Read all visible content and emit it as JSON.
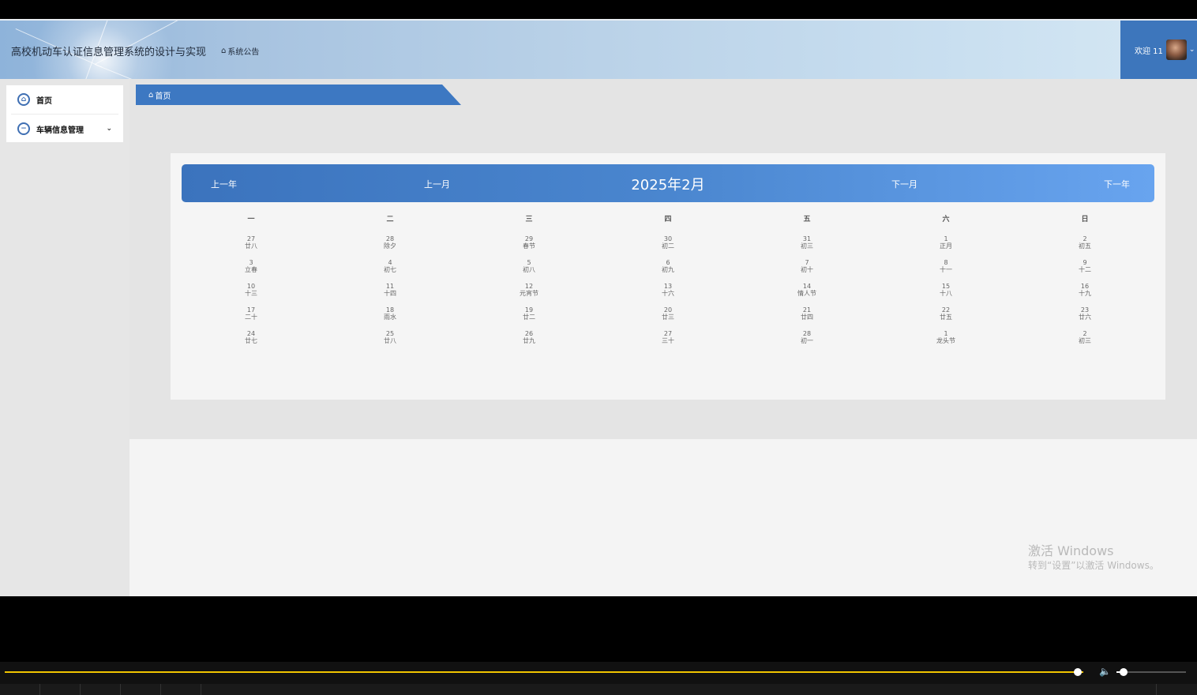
{
  "header": {
    "app_title": "高校机动车认证信息管理系统的设计与实现",
    "notice_label": "系统公告",
    "welcome_text": "欢迎 11"
  },
  "sidebar": {
    "items": [
      {
        "label": "首页",
        "icon": "home-icon"
      },
      {
        "label": "车辆信息管理",
        "icon": "minus-circle-icon"
      }
    ]
  },
  "breadcrumb": {
    "label": "首页",
    "icon": "home-icon"
  },
  "calendar": {
    "title": "2025年2月",
    "prev_year": "上一年",
    "prev_month": "上一月",
    "next_month": "下一月",
    "next_year": "下一年",
    "weekdays": [
      "一",
      "二",
      "三",
      "四",
      "五",
      "六",
      "日"
    ],
    "weeks": [
      [
        {
          "d": "27",
          "l": "廿八"
        },
        {
          "d": "28",
          "l": "除夕"
        },
        {
          "d": "29",
          "l": "春节"
        },
        {
          "d": "30",
          "l": "初二"
        },
        {
          "d": "31",
          "l": "初三"
        },
        {
          "d": "1",
          "l": "正月"
        },
        {
          "d": "2",
          "l": "初五"
        }
      ],
      [
        {
          "d": "3",
          "l": "立春"
        },
        {
          "d": "4",
          "l": "初七"
        },
        {
          "d": "5",
          "l": "初八"
        },
        {
          "d": "6",
          "l": "初九"
        },
        {
          "d": "7",
          "l": "初十"
        },
        {
          "d": "8",
          "l": "十一"
        },
        {
          "d": "9",
          "l": "十二"
        }
      ],
      [
        {
          "d": "10",
          "l": "十三"
        },
        {
          "d": "11",
          "l": "十四"
        },
        {
          "d": "12",
          "l": "元宵节"
        },
        {
          "d": "13",
          "l": "十六"
        },
        {
          "d": "14",
          "l": "情人节"
        },
        {
          "d": "15",
          "l": "十八"
        },
        {
          "d": "16",
          "l": "十九"
        }
      ],
      [
        {
          "d": "17",
          "l": "二十"
        },
        {
          "d": "18",
          "l": "雨水"
        },
        {
          "d": "19",
          "l": "廿二"
        },
        {
          "d": "20",
          "l": "廿三"
        },
        {
          "d": "21",
          "l": "廿四"
        },
        {
          "d": "22",
          "l": "廿五"
        },
        {
          "d": "23",
          "l": "廿六"
        }
      ],
      [
        {
          "d": "24",
          "l": "廿七"
        },
        {
          "d": "25",
          "l": "廿八"
        },
        {
          "d": "26",
          "l": "廿九"
        },
        {
          "d": "27",
          "l": "三十"
        },
        {
          "d": "28",
          "l": "初一"
        },
        {
          "d": "1",
          "l": "龙头节"
        },
        {
          "d": "2",
          "l": "初三"
        }
      ]
    ]
  },
  "watermark": {
    "line1": "激活 Windows",
    "line2": "转到“设置”以激活 Windows。"
  },
  "player": {
    "progress": 0.995,
    "volume": 0.1
  },
  "colors": {
    "accent": "#3d78c2",
    "progress": "#f0c400"
  }
}
